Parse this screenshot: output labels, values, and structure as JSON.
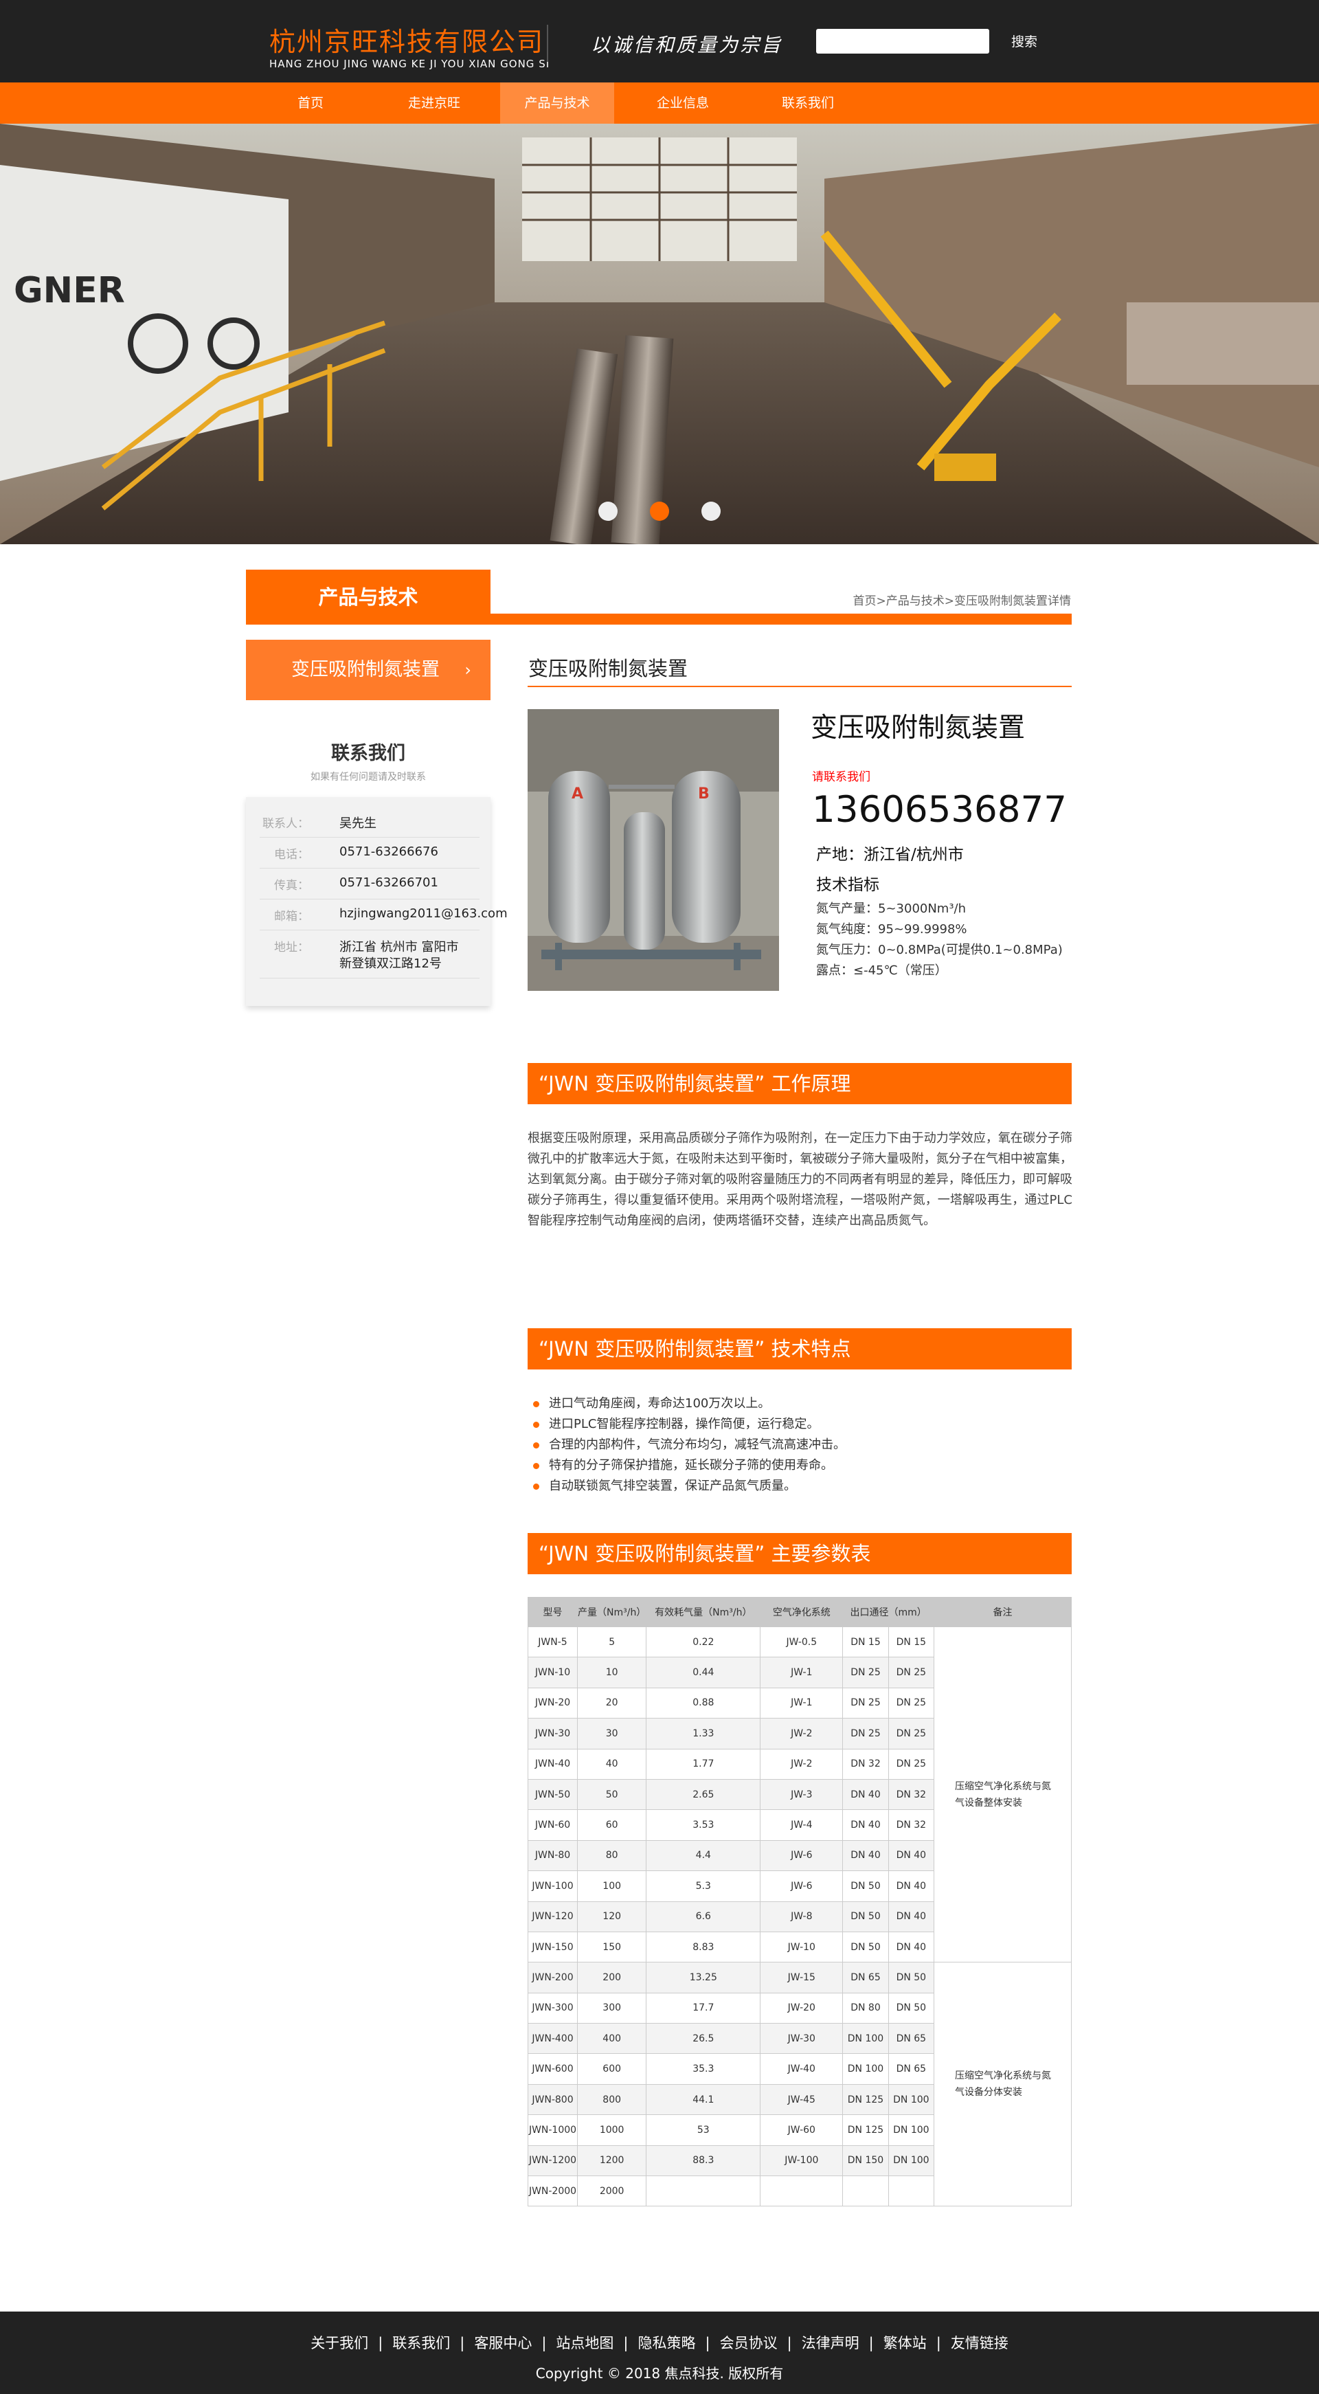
{
  "header": {
    "company_cn": "杭州京旺科技有限公司",
    "company_en": "HANG ZHOU JING WANG KE JI YOU XIAN GONG SI",
    "slogan": "以诚信和质量为宗旨",
    "search_placeholder": "",
    "search_label": "搜索"
  },
  "nav": [
    "首页",
    "走进京旺",
    "产品与技术",
    "企业信息",
    "联系我们"
  ],
  "banner": {
    "slides": 3,
    "active_slide": 2,
    "text": "GNER"
  },
  "section": {
    "title": "产品与技术",
    "breadcrumb": [
      "首页",
      "产品与技术",
      "变压吸附制氮装置详情"
    ]
  },
  "sidebar": {
    "category": "变压吸附制氮装置",
    "contact_title": "联系我们",
    "contact_sub": "如果有任何问题请及时联系",
    "contacts": [
      {
        "label": "联系人：",
        "value": "吴先生"
      },
      {
        "label": "电话：",
        "value": "0571-63266676"
      },
      {
        "label": "传真：",
        "value": "0571-63266701"
      },
      {
        "label": "邮箱：",
        "value": "hzjingwang2011@163.com"
      },
      {
        "label": "地址：",
        "value": "浙江省 杭州市 富阳市",
        "value2": "新登镇双江路12号"
      }
    ]
  },
  "product": {
    "list_title": "变压吸附制氮装置",
    "name": "变压吸附制氮装置",
    "contact_link": "请联系我们",
    "phone": "13606536877",
    "origin": "产地：浙江省/杭州市",
    "specs_title": "技术指标",
    "specs": [
      "氮气产量：5~3000Nm³/h",
      "氮气纯度：95~99.9998%",
      "氮气压力：0~0.8MPa(可提供0.1~0.8MPa)",
      "露点：≤-45℃（常压）"
    ]
  },
  "principle": {
    "title": "“JWN 变压吸附制氮装置” 工作原理",
    "text": "根据变压吸附原理，采用高品质碳分子筛作为吸附剂，在一定压力下由于动力学效应，氧在碳分子筛微孔中的扩散率远大于氮，在吸附未达到平衡时，氧被碳分子筛大量吸附，氮分子在气相中被富集，达到氧氮分离。由于碳分子筛对氧的吸附容量随压力的不同两者有明显的差异，降低压力，即可解吸碳分子筛再生，得以重复循环使用。采用两个吸附塔流程，一塔吸附产氮，一塔解吸再生，通过PLC智能程序控制气动角座阀的启闭，使两塔循环交替，连续产出高品质氮气。"
  },
  "features": {
    "title": "“JWN 变压吸附制氮装置” 技术特点",
    "items": [
      "进口气动角座阀，寿命达100万次以上。",
      "进口PLC智能程序控制器，操作简便，运行稳定。",
      "合理的内部构件，气流分布均匀，减轻气流高速冲击。",
      "特有的分子筛保护措施，延长碳分子筛的使用寿命。",
      "自动联锁氮气排空装置，保证产品氮气质量。"
    ]
  },
  "params": {
    "title": "“JWN 变压吸附制氮装置” 主要参数表",
    "headers": [
      "型号",
      "产量（Nm³/h）",
      "有效耗气量（Nm³/h）",
      "空气净化系统",
      "出口通径（mm）",
      "备注"
    ],
    "rows": [
      [
        "JWN-5",
        "5",
        "0.22",
        "JW-0.5",
        "DN 15",
        "DN 15"
      ],
      [
        "JWN-10",
        "10",
        "0.44",
        "JW-1",
        "DN 25",
        "DN 25"
      ],
      [
        "JWN-20",
        "20",
        "0.88",
        "JW-1",
        "DN 25",
        "DN 25"
      ],
      [
        "JWN-30",
        "30",
        "1.33",
        "JW-2",
        "DN 25",
        "DN 25"
      ],
      [
        "JWN-40",
        "40",
        "1.77",
        "JW-2",
        "DN 32",
        "DN 25"
      ],
      [
        "JWN-50",
        "50",
        "2.65",
        "JW-3",
        "DN 40",
        "DN 32"
      ],
      [
        "JWN-60",
        "60",
        "3.53",
        "JW-4",
        "DN 40",
        "DN 32"
      ],
      [
        "JWN-80",
        "80",
        "4.4",
        "JW-6",
        "DN 40",
        "DN 40"
      ],
      [
        "JWN-100",
        "100",
        "5.3",
        "JW-6",
        "DN 50",
        "DN 40"
      ],
      [
        "JWN-120",
        "120",
        "6.6",
        "JW-8",
        "DN 50",
        "DN 40"
      ],
      [
        "JWN-150",
        "150",
        "8.83",
        "JW-10",
        "DN 50",
        "DN 40"
      ],
      [
        "JWN-200",
        "200",
        "13.25",
        "JW-15",
        "DN 65",
        "DN 50"
      ],
      [
        "JWN-300",
        "300",
        "17.7",
        "JW-20",
        "DN 80",
        "DN 50"
      ],
      [
        "JWN-400",
        "400",
        "26.5",
        "JW-30",
        "DN 100",
        "DN 65"
      ],
      [
        "JWN-600",
        "600",
        "35.3",
        "JW-40",
        "DN 100",
        "DN 65"
      ],
      [
        "JWN-800",
        "800",
        "44.1",
        "JW-45",
        "DN 125",
        "DN 100"
      ],
      [
        "JWN-1000",
        "1000",
        "53",
        "JW-60",
        "DN 125",
        "DN 100"
      ],
      [
        "JWN-1200",
        "1200",
        "88.3",
        "JW-100",
        "DN 150",
        "DN 100"
      ],
      [
        "JWN-2000",
        "2000",
        "",
        "",
        "",
        ""
      ]
    ],
    "note1": "压缩空气净化系统与氮气设备整体安装",
    "note2": "压缩空气净化系统与氮气设备分体安装"
  },
  "footer": {
    "links": [
      "关于我们",
      "联系我们",
      "客服中心",
      "站点地图",
      "隐私策略",
      "会员协议",
      "法律声明",
      "繁体站",
      "友情链接"
    ],
    "copyright": "Copyright © 2018 焦点科技. 版权所有"
  },
  "colors": {
    "accent": "#ff6a00",
    "dark": "#222222"
  }
}
